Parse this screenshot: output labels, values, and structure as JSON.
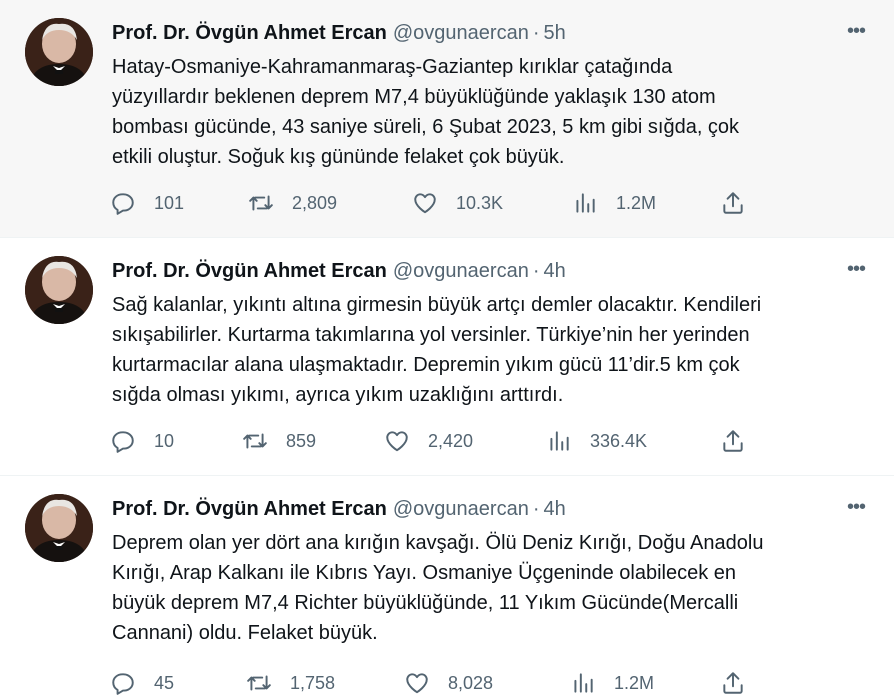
{
  "tweets": [
    {
      "author_name": "Prof. Dr. Övgün Ahmet Ercan",
      "handle": "@ovgunaercan",
      "separator": "·",
      "time": "5h",
      "more": "•••",
      "text": "Hatay-Osmaniye-Kahramanmaraş-Gaziantep kırıklar çatağında\nyüzyıllardır beklenen deprem M7,4 büyüklüğünde yaklaşık 130 atom\nbombası gücünde, 43 saniye süreli, 6 Şubat 2023, 5 km gibi sığda, çok\netkili oluştur. Soğuk kış gününde felaket çok büyük.",
      "replies": "101",
      "retweets": "2,809",
      "likes": "10.3K",
      "views": "1.2M"
    },
    {
      "author_name": "Prof. Dr. Övgün Ahmet Ercan",
      "handle": "@ovgunaercan",
      "separator": "·",
      "time": "4h",
      "more": "•••",
      "text": "Sağ kalanlar, yıkıntı altına girmesin büyük artçı demler olacaktır. Kendileri\nsıkışabilirler. Kurtarma takımlarına yol versinler. Türkiye’nin her yerinden\nkurtarmacılar alana ulaşmaktadır. Depremin yıkım gücü 11’dir.5 km çok\nsığda olması yıkımı, ayrıca yıkım uzaklığını arttırdı.",
      "replies": "10",
      "retweets": "859",
      "likes": "2,420",
      "views": "336.4K"
    },
    {
      "author_name": "Prof. Dr. Övgün Ahmet Ercan",
      "handle": "@ovgunaercan",
      "separator": "·",
      "time": "4h",
      "more": "•••",
      "text": "Deprem olan yer dört ana kırığın kavşağı. Ölü Deniz Kırığı, Doğu Anadolu\nKırığı, Arap Kalkanı ile Kıbrıs Yayı. Osmaniye Üçgeninde olabilecek en\nbüyük deprem M7,4 Richter büyüklüğünde, 11 Yıkım Gücünde(Mercalli\nCannani) oldu. Felaket büyük.",
      "replies": "45",
      "retweets": "1,758",
      "likes": "8,028",
      "views": "1.2M"
    }
  ],
  "icons": {
    "reply": "reply-icon",
    "retweet": "retweet-icon",
    "like": "heart-icon",
    "views": "views-icon",
    "share": "share-icon"
  },
  "colors": {
    "text": "#0f1419",
    "secondary": "#536471",
    "highlight_bg": "#f7f7f7",
    "divider": "#eff3f4"
  }
}
